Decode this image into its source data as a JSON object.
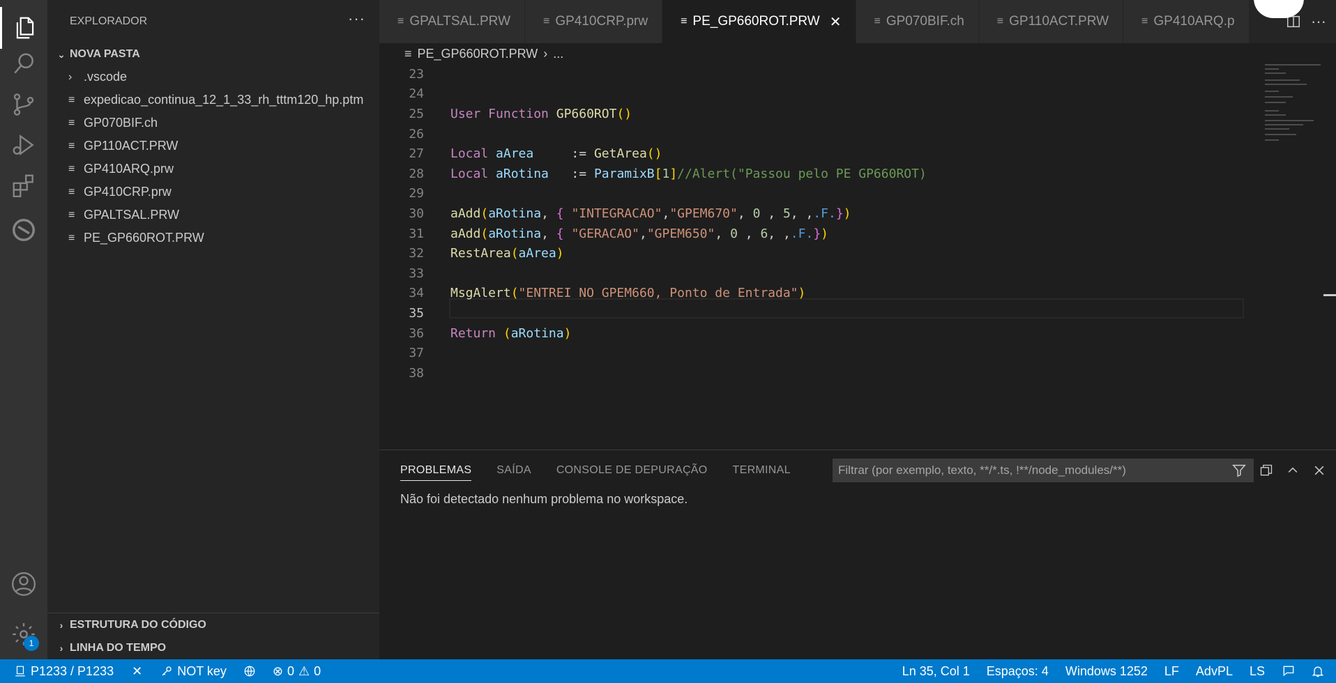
{
  "explorer": {
    "title": "EXPLORADOR",
    "more": "···",
    "folder": "NOVA PASTA",
    "items": [
      {
        "label": ".vscode",
        "type": "folder"
      },
      {
        "label": "expedicao_continua_12_1_33_rh_tttm120_hp.ptm",
        "type": "file"
      },
      {
        "label": "GP070BIF.ch",
        "type": "file"
      },
      {
        "label": "GP110ACT.PRW",
        "type": "file"
      },
      {
        "label": "GP410ARQ.prw",
        "type": "file"
      },
      {
        "label": "GP410CRP.prw",
        "type": "file"
      },
      {
        "label": "GPALTSAL.PRW",
        "type": "file"
      },
      {
        "label": "PE_GP660ROT.PRW",
        "type": "file"
      }
    ],
    "outline": "ESTRUTURA DO CÓDIGO",
    "timeline": "LINHA DO TEMPO"
  },
  "activity": {
    "settings_badge": "1",
    "icons": [
      "files-icon",
      "search-icon",
      "source-control-icon",
      "run-debug-icon",
      "extensions-icon",
      "totvs-icon",
      "account-icon",
      "settings-gear-icon"
    ]
  },
  "tabs": [
    {
      "label": "GPALTSAL.PRW",
      "active": false
    },
    {
      "label": "GP410CRP.prw",
      "active": false
    },
    {
      "label": "PE_GP660ROT.PRW",
      "active": true
    },
    {
      "label": "GP070BIF.ch",
      "active": false
    },
    {
      "label": "GP110ACT.PRW",
      "active": false
    },
    {
      "label": "GP410ARQ.p",
      "active": false
    }
  ],
  "breadcrumb": {
    "file": "PE_GP660ROT.PRW",
    "more": "..."
  },
  "editor": {
    "current_line": 35,
    "lines": [
      {
        "n": "23",
        "code": ""
      },
      {
        "n": "24",
        "code": ""
      },
      {
        "n": "25",
        "code": "User Function GP660ROT()"
      },
      {
        "n": "26",
        "code": ""
      },
      {
        "n": "27",
        "code": "Local aArea     := GetArea()"
      },
      {
        "n": "28",
        "code": "Local aRotina   := ParamixB[1]//Alert(\"Passou pelo PE GP660ROT)"
      },
      {
        "n": "29",
        "code": ""
      },
      {
        "n": "30",
        "code": "aAdd(aRotina, { \"INTEGRACAO\",\"GPEM670\", 0 , 5, ,.F.})"
      },
      {
        "n": "31",
        "code": "aAdd(aRotina, { \"GERACAO\",\"GPEM650\", 0 , 6, ,.F.})"
      },
      {
        "n": "32",
        "code": "RestArea(aArea)"
      },
      {
        "n": "33",
        "code": ""
      },
      {
        "n": "34",
        "code": "MsgAlert(\"ENTREI NO GPEM660, Ponto de Entrada\")"
      },
      {
        "n": "35",
        "code": ""
      },
      {
        "n": "36",
        "code": "Return (aRotina)"
      },
      {
        "n": "37",
        "code": ""
      },
      {
        "n": "38",
        "code": ""
      }
    ]
  },
  "panel": {
    "tabs": [
      "PROBLEMAS",
      "SAÍDA",
      "CONSOLE DE DEPURAÇÃO",
      "TERMINAL"
    ],
    "active_tab": "PROBLEMAS",
    "filter_placeholder": "Filtrar (por exemplo, texto, **/*.ts, !**/node_modules/**)",
    "message": "Não foi detectado nenhum problema no workspace."
  },
  "statusbar": {
    "connection": "P1233 / P1233",
    "close": "✕",
    "key": "NOT key",
    "errors": "0",
    "warnings": "0",
    "position": "Ln 35, Col 1",
    "spaces": "Espaços: 4",
    "encoding": "Windows 1252",
    "eol": "LF",
    "language": "AdvPL",
    "ls": "LS",
    "accent": "#007acc"
  }
}
